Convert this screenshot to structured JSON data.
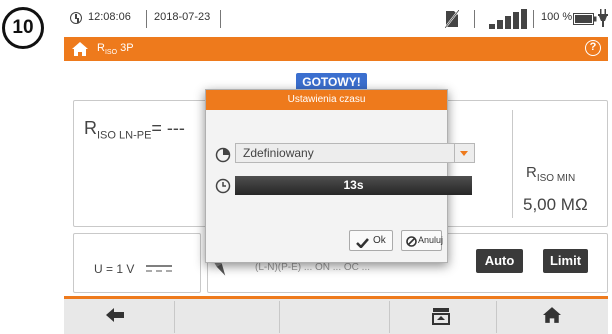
{
  "step_number": "10",
  "status_bar": {
    "time": "12:08:06",
    "date": "2018-07-23",
    "battery_percent": "100 %",
    "icons": [
      "clock-icon",
      "no-sim-icon",
      "signal-bars-icon",
      "battery-icon",
      "power-plug-icon"
    ]
  },
  "header": {
    "title_main": "R",
    "title_sub": "ISO",
    "title_suffix": " 3P",
    "help_label": "?",
    "icons": [
      "home-icon",
      "help-icon"
    ]
  },
  "main": {
    "status_badge": "GOTOWY!",
    "result_label_main": "R",
    "result_label_sub": "ISO LN-PE",
    "result_value": "= ---",
    "rmin_label_main": "R",
    "rmin_label_sub": "ISO MIN",
    "rmin_value": "5,00 MΩ",
    "voltage_label": "U = 1 V",
    "partial_text": "(L-N)(P-E)  ...  ON  ...  OC ...",
    "auto_button": "Auto",
    "limit_button": "Limit"
  },
  "modal": {
    "title": "Ustawienia czasu",
    "mode_value": "Zdefiniowany",
    "time_value": "13s",
    "ok_label": "Ok",
    "cancel_label": "Anuluj",
    "icons": [
      "timer-icon",
      "clock-icon",
      "check-icon",
      "cancel-icon",
      "dropdown-arrow-icon"
    ]
  },
  "toolbar": {
    "icons": [
      "arrow-left-icon",
      "save-memory-icon",
      "home-icon"
    ]
  },
  "colors": {
    "accent_orange": "#ee7a1c",
    "badge_blue": "#3b6fcf",
    "dark_button": "#3a3a3a"
  }
}
